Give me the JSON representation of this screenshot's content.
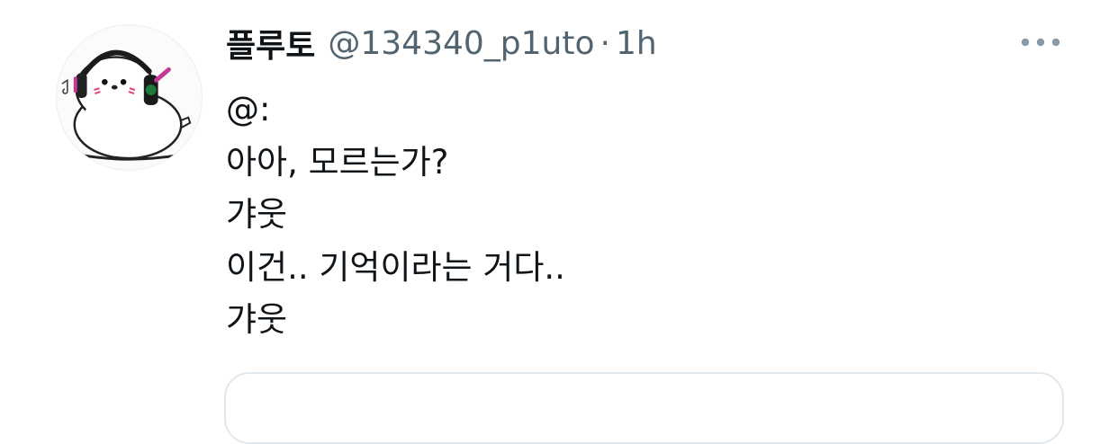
{
  "tweet": {
    "display_name": "플루토",
    "handle": "@134340_p1uto",
    "separator": "·",
    "timestamp": "1h",
    "more_icon": "more-horizontal-icon",
    "avatar_icon": "bird-with-headphones-avatar",
    "body_lines": [
      "@:",
      "아아, 모르는가?",
      "갸웃",
      "이건.. 기억이라는 거다..",
      "갸웃"
    ]
  },
  "colors": {
    "text_primary": "#0f1419",
    "text_secondary": "#536471",
    "card_border": "#e1e8ed",
    "background": "#ffffff"
  }
}
